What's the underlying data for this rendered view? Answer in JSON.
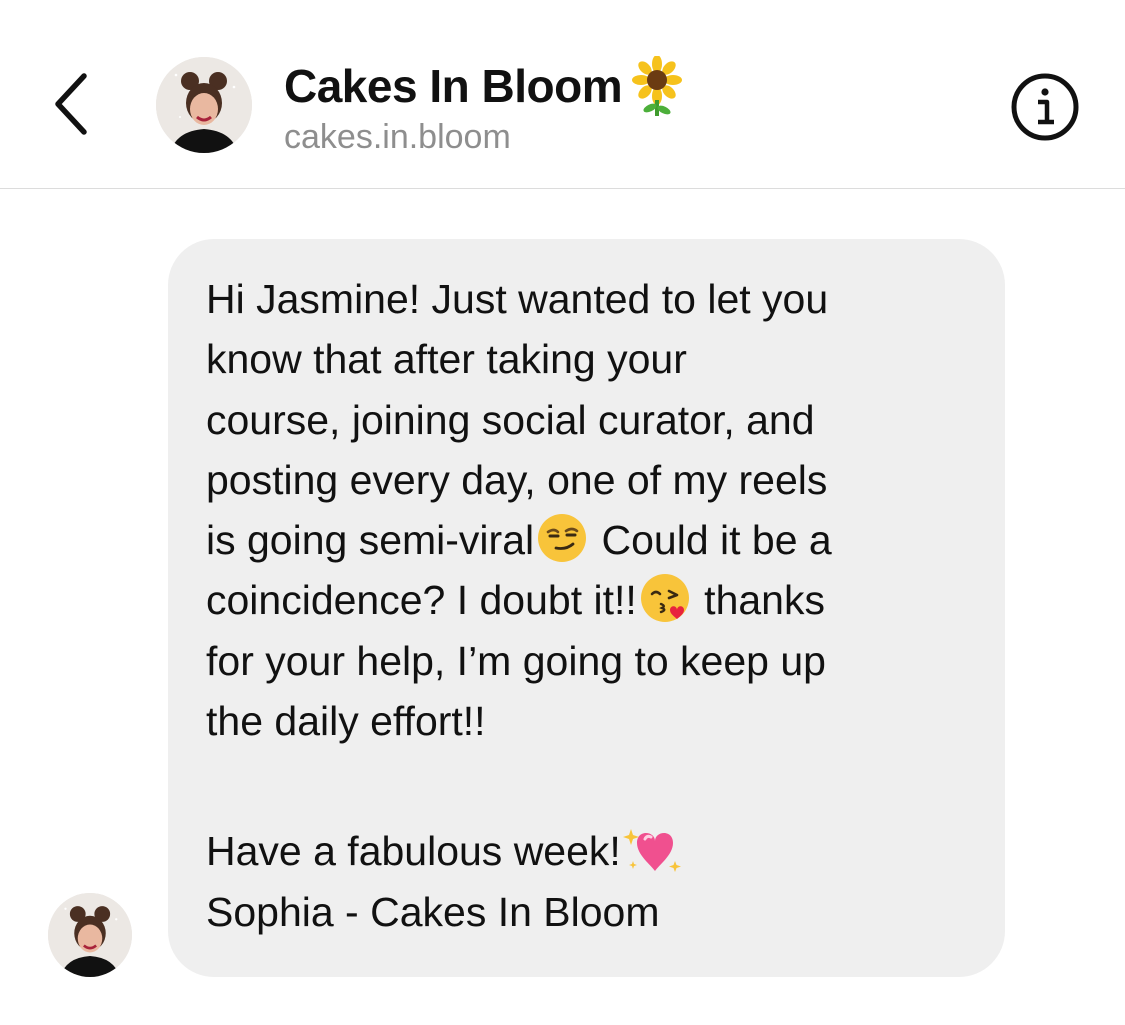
{
  "header": {
    "contact_name": "Cakes In Bloom",
    "username": "cakes.in.bloom",
    "name_emoji": "sunflower-icon"
  },
  "message": {
    "lines": [
      "Hi Jasmine! Just wanted to let you",
      "know that after taking your",
      "course, joining social curator, and",
      "posting every day, one of my reels",
      "is going semi-viral",
      " Could it be a",
      "coincidence? I doubt it!!",
      " thanks",
      "for your help, I’m going to keep up",
      "the daily effort!!",
      "Have a fabulous week!",
      "Sophia - Cakes In Bloom"
    ],
    "emojis": [
      "smirk-emoji",
      "kiss-emoji",
      "sparkling-heart-emoji"
    ]
  },
  "colors": {
    "bubble_bg": "#efefef",
    "secondary_text": "#8e8e8e",
    "divider": "#dcdcdc"
  }
}
